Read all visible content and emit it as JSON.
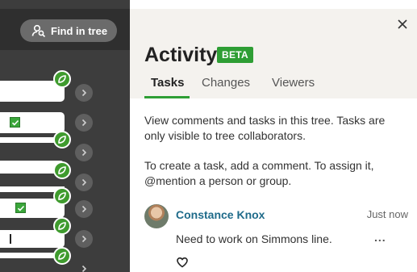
{
  "tree": {
    "find_button_label": "Find in tree",
    "find_icon": "person-search-icon"
  },
  "panel": {
    "title": "Activity",
    "badge": "BETA",
    "close_icon": "close-icon",
    "tabs": [
      {
        "label": "Tasks",
        "active": true
      },
      {
        "label": "Changes",
        "active": false
      },
      {
        "label": "Viewers",
        "active": false
      }
    ],
    "description_1": "View comments and tasks in this tree. Tasks are only visible to tree collaborators.",
    "description_2": "To create a task, add a comment. To assign it, @mention a person or group."
  },
  "comment": {
    "author": "Constance Knox",
    "timestamp": "Just now",
    "text": "Need to work on Simmons line.",
    "more_label": "...",
    "like_icon": "heart-outline-icon"
  },
  "colors": {
    "accent_green": "#2e9e34",
    "author_link": "#1f6b8a",
    "tree_background": "#3d3d3d"
  }
}
